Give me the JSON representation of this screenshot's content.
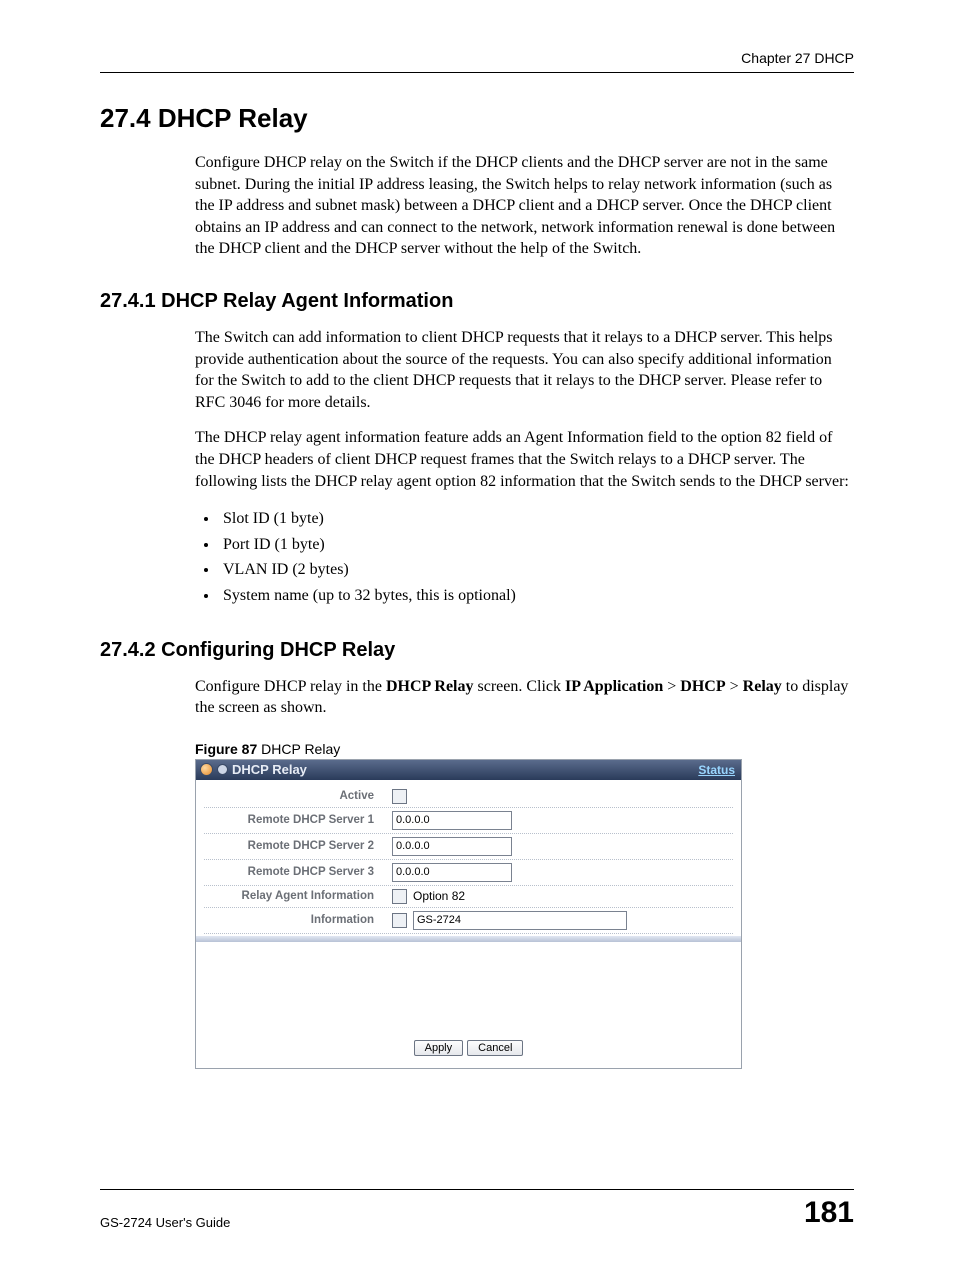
{
  "header": {
    "chapter": "Chapter 27 DHCP"
  },
  "section": {
    "number_title": "27.4  DHCP Relay",
    "intro": "Configure DHCP relay on the Switch if the DHCP clients and the DHCP server are not in the same subnet. During the initial IP address leasing, the Switch helps to relay network information (such as the IP address and subnet mask) between a DHCP client and a DHCP server. Once the DHCP client obtains an IP address and can connect to the network, network information renewal is done between the DHCP client and the DHCP server without the help of the Switch."
  },
  "sub1": {
    "title": "27.4.1  DHCP Relay Agent Information",
    "p1": "The Switch can add information to client DHCP requests that it relays to a DHCP server. This helps provide authentication about the source of the requests. You can also specify additional information for the Switch to add to the client DHCP requests that it relays to the DHCP server. Please refer to RFC 3046 for more details.",
    "p2": "The DHCP relay agent information feature adds an Agent Information field to the option 82 field of the DHCP headers of client DHCP request frames that the Switch relays to a DHCP server. The following lists the DHCP relay agent option 82 information that the Switch sends to the DHCP server:",
    "bullets": [
      "Slot ID (1 byte)",
      "Port ID (1 byte)",
      "VLAN ID (2 bytes)",
      "System name (up to 32 bytes, this is optional)"
    ]
  },
  "sub2": {
    "title": "27.4.2  Configuring DHCP Relay",
    "p1_pre": "Configure DHCP relay in the ",
    "p1_b1": "DHCP Relay",
    "p1_mid1": " screen. Click ",
    "p1_b2": "IP Application",
    "p1_gt1": " > ",
    "p1_b3": "DHCP",
    "p1_gt2": " > ",
    "p1_b4": "Relay",
    "p1_post": " to display the screen as shown."
  },
  "figure": {
    "label": "Figure 87",
    "caption": "   DHCP Relay",
    "titlebar_title": "DHCP Relay",
    "titlebar_status": "Status",
    "rows": {
      "active": "Active",
      "server1": "Remote DHCP Server 1",
      "server1_val": "0.0.0.0",
      "server2": "Remote DHCP Server 2",
      "server2_val": "0.0.0.0",
      "server3": "Remote DHCP Server 3",
      "server3_val": "0.0.0.0",
      "rai": "Relay Agent Information",
      "rai_opt": "Option 82",
      "info": "Information",
      "info_val": "GS-2724"
    },
    "buttons": {
      "apply": "Apply",
      "cancel": "Cancel"
    }
  },
  "footer": {
    "guide": "GS-2724 User's Guide",
    "page": "181"
  }
}
